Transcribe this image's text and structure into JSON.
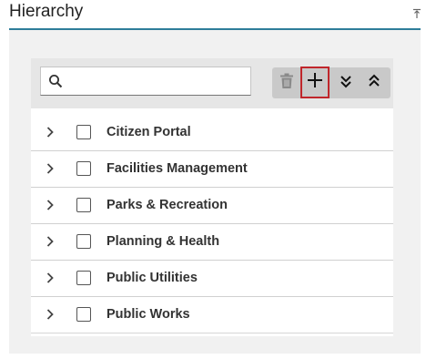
{
  "panel": {
    "title": "Hierarchy"
  },
  "search": {
    "placeholder": "",
    "value": ""
  },
  "toolbar": {
    "buttons": [
      {
        "name": "delete",
        "icon": "trash-icon",
        "enabled": false
      },
      {
        "name": "add",
        "icon": "plus-icon",
        "enabled": true
      },
      {
        "name": "expand-all",
        "icon": "double-chevron-down-icon",
        "enabled": true
      },
      {
        "name": "collapse-all",
        "icon": "double-chevron-up-icon",
        "enabled": true
      }
    ]
  },
  "tree": {
    "items": [
      {
        "label": "Citizen Portal",
        "checked": false,
        "expanded": false
      },
      {
        "label": "Facilities Management",
        "checked": false,
        "expanded": false
      },
      {
        "label": "Parks & Recreation",
        "checked": false,
        "expanded": false
      },
      {
        "label": "Planning & Health",
        "checked": false,
        "expanded": false
      },
      {
        "label": "Public Utilities",
        "checked": false,
        "expanded": false
      },
      {
        "label": "Public Works",
        "checked": false,
        "expanded": false
      }
    ]
  },
  "colors": {
    "accent": "#2e7d9a",
    "focus": "#c0262b"
  }
}
